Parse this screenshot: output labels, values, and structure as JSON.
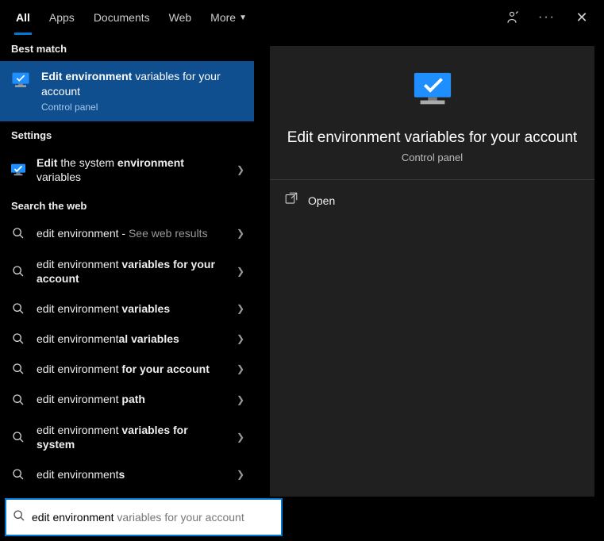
{
  "tabs": {
    "all": "All",
    "apps": "Apps",
    "documents": "Documents",
    "web": "Web",
    "more": "More"
  },
  "sections": {
    "best": "Best match",
    "settings": "Settings",
    "web": "Search the web"
  },
  "best": {
    "title_strong": "Edit environment",
    "title_rest": " variables for your account",
    "subtitle": "Control panel"
  },
  "settingsItem": {
    "pre": "Edit",
    "mid": " the system ",
    "strong2": "environment",
    "rest": " variables"
  },
  "web": [
    {
      "pre": "edit environment",
      "strong": "",
      "suffix": " - ",
      "dim": "See web results"
    },
    {
      "pre": "edit environment ",
      "strong": "variables for your account",
      "suffix": "",
      "dim": ""
    },
    {
      "pre": "edit environment ",
      "strong": "variables",
      "suffix": "",
      "dim": ""
    },
    {
      "pre": "edit environment",
      "strong": "al variables",
      "suffix": "",
      "dim": ""
    },
    {
      "pre": "edit environment ",
      "strong": "for your account",
      "suffix": "",
      "dim": ""
    },
    {
      "pre": "edit environment ",
      "strong": "path",
      "suffix": "",
      "dim": ""
    },
    {
      "pre": "edit environment ",
      "strong": "variables for system",
      "suffix": "",
      "dim": ""
    },
    {
      "pre": "edit environment",
      "strong": "s",
      "suffix": "",
      "dim": ""
    }
  ],
  "preview": {
    "title": "Edit environment variables for your account",
    "subtitle": "Control panel",
    "open": "Open"
  },
  "search": {
    "typed": "edit environment",
    "ghost": " variables for your account"
  }
}
